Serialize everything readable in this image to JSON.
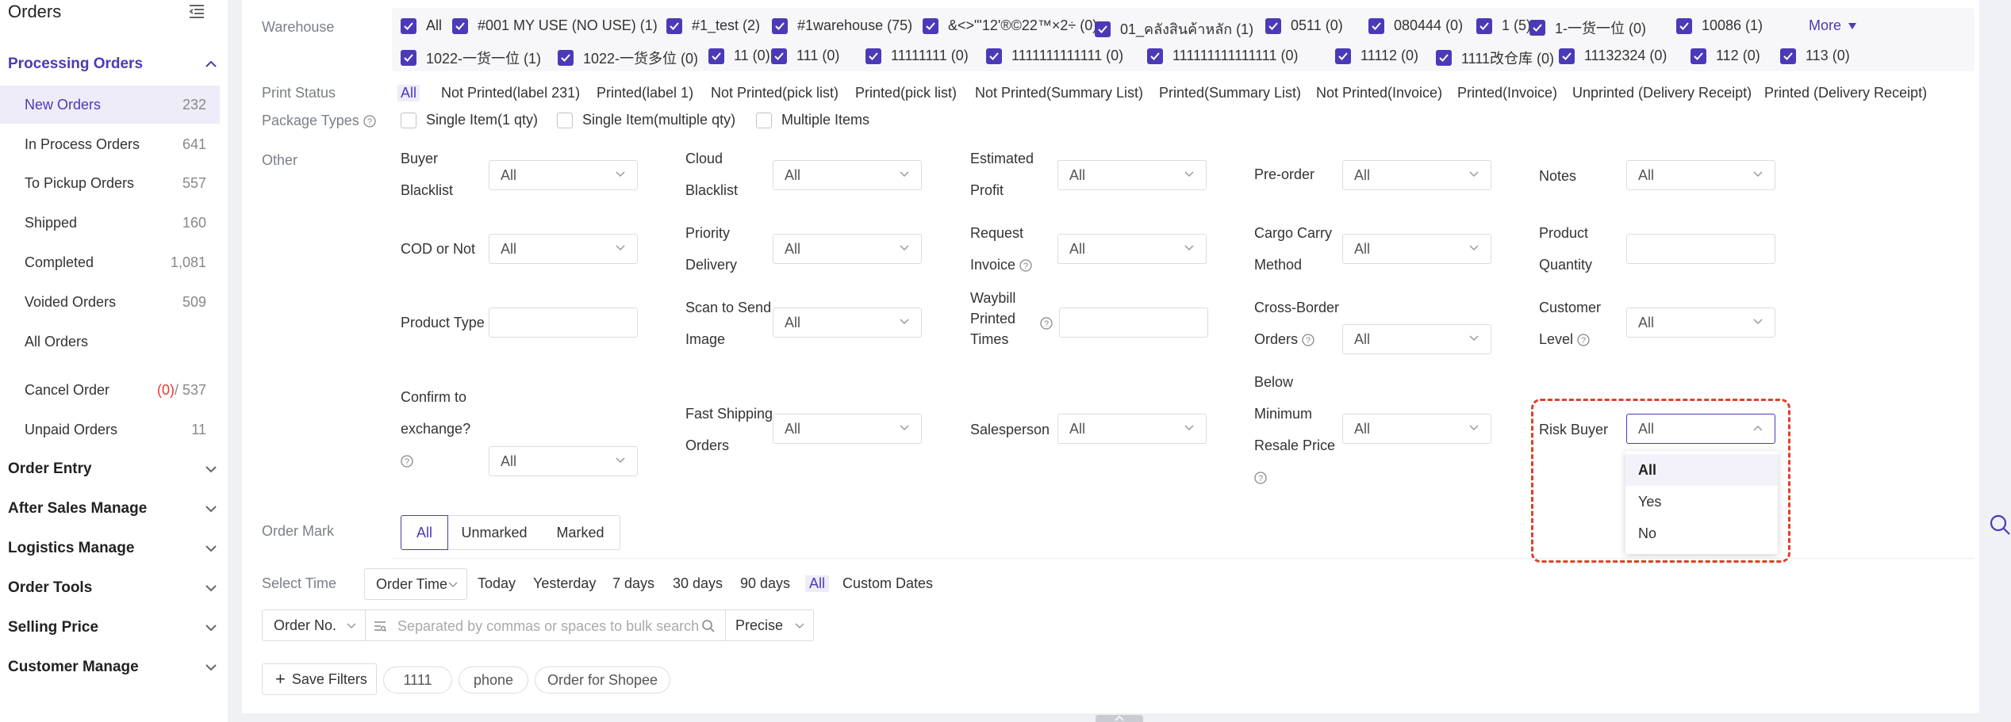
{
  "sidebar": {
    "title": "Orders",
    "collapse_icon": "menu-collapse-icon",
    "processing": {
      "label": "Processing Orders",
      "items": [
        {
          "label": "New Orders",
          "count": "232"
        },
        {
          "label": "In Process Orders",
          "count": "641"
        },
        {
          "label": "To Pickup Orders",
          "count": "557"
        },
        {
          "label": "Shipped",
          "count": "160"
        },
        {
          "label": "Completed",
          "count": "1,081"
        },
        {
          "label": "Voided Orders",
          "count": "509"
        },
        {
          "label": "All Orders",
          "count": ""
        }
      ]
    },
    "cancel": {
      "label": "Cancel Order",
      "count_red": "(0)",
      "count_rest": "/ 537"
    },
    "unpaid": {
      "label": "Unpaid Orders",
      "count": "11"
    },
    "groups": [
      "Order Entry",
      "After Sales Manage",
      "Logistics Manage",
      "Order Tools",
      "Selling Price",
      "Customer Manage"
    ]
  },
  "filters": {
    "warehouse": {
      "label": "Warehouse",
      "row1": [
        "All",
        "#001 MY USE (NO USE) (1)",
        "#1_test (2)",
        "#1warehouse (75)",
        "&<>\"'12'®©22™×2÷ (0)",
        "01_คลังสินค้าหลัก (1)",
        "0511 (0)",
        "080444 (0)",
        "1 (5)",
        "1-一货一位 (0)",
        "10086 (1)"
      ],
      "row2": [
        "1022-一货一位 (1)",
        "1022-一货多位 (0)",
        "11 (0)",
        "111 (0)",
        "11111111 (0)",
        "1111111111111 (0)",
        "111111111111111 (0)",
        "11112 (0)",
        "1111改仓库 (0)",
        "11132324 (0)",
        "112 (0)",
        "113 (0)"
      ],
      "more": "More"
    },
    "print_status": {
      "label": "Print Status",
      "options": [
        "All",
        "Not Printed(label 231)",
        "Printed(label 1)",
        "Not Printed(pick list)",
        "Printed(pick list)",
        "Not Printed(Summary List)",
        "Printed(Summary List)",
        "Not Printed(Invoice)",
        "Printed(Invoice)",
        "Unprinted (Delivery Receipt)",
        "Printed (Delivery Receipt)"
      ]
    },
    "package_types": {
      "label": "Package Types",
      "options": [
        "Single Item(1 qty)",
        "Single Item(multiple qty)",
        "Multiple Items"
      ]
    },
    "other": {
      "label": "Other",
      "buyer_blacklist": {
        "l1": "Buyer",
        "l2": "Blacklist",
        "value": "All"
      },
      "cloud_blacklist": {
        "l1": "Cloud",
        "l2": "Blacklist",
        "value": "All"
      },
      "estimated_profit": {
        "l1": "Estimated",
        "l2": "Profit",
        "value": "All"
      },
      "pre_order": {
        "l1": "Pre-order",
        "value": "All"
      },
      "notes": {
        "l1": "Notes",
        "value": "All"
      },
      "cod": {
        "l1": "COD or Not",
        "value": "All"
      },
      "priority_delivery": {
        "l1": "Priority",
        "l2": "Delivery",
        "value": "All"
      },
      "request_invoice": {
        "l1": "Request",
        "l2": "Invoice",
        "value": "All"
      },
      "cargo_carry": {
        "l1": "Cargo Carry",
        "l2": "Method",
        "value": "All"
      },
      "product_quantity": {
        "l1": "Product",
        "l2": "Quantity",
        "value": ""
      },
      "product_type": {
        "l1": "Product Type",
        "value": ""
      },
      "scan_to_send": {
        "l1": "Scan to Send",
        "l2": "Image",
        "value": "All"
      },
      "waybill_printed": {
        "l1": "Waybill",
        "l2": "Printed",
        "l3": "Times",
        "value": ""
      },
      "cross_border": {
        "l1": "Cross-Border",
        "l2": "Orders",
        "value": "All"
      },
      "customer_level": {
        "l1": "Customer",
        "l2": "Level",
        "value": "All"
      },
      "confirm_exchange": {
        "l1": "Confirm to",
        "l2": "exchange?",
        "value": "All"
      },
      "fast_shipping": {
        "l1": "Fast Shipping",
        "l2": "Orders",
        "value": "All"
      },
      "salesperson": {
        "l1": "Salesperson",
        "value": "All"
      },
      "below_min_resale": {
        "l1": "Below",
        "l2": "Minimum",
        "l3": "Resale Price",
        "value": "All"
      },
      "risk_buyer": {
        "l1": "Risk Buyer",
        "value": "All",
        "options": [
          "All",
          "Yes",
          "No"
        ]
      }
    },
    "order_mark": {
      "label": "Order Mark",
      "options": [
        "All",
        "Unmarked",
        "Marked"
      ]
    },
    "select_time": {
      "label": "Select Time",
      "type": "Order Time",
      "options": [
        "Today",
        "Yesterday",
        "7 days",
        "30 days",
        "90 days",
        "All",
        "Custom Dates"
      ]
    },
    "search": {
      "field": "Order No.",
      "placeholder": "Separated by commas or spaces to bulk search",
      "mode": "Precise"
    },
    "saved": {
      "save_label": "Save Filters",
      "pills": [
        "1111",
        "phone",
        "Order for Shopee"
      ]
    }
  },
  "colors": {
    "accent": "#4b3ab8",
    "highlight": "#e0402a",
    "danger": "#e53935"
  }
}
